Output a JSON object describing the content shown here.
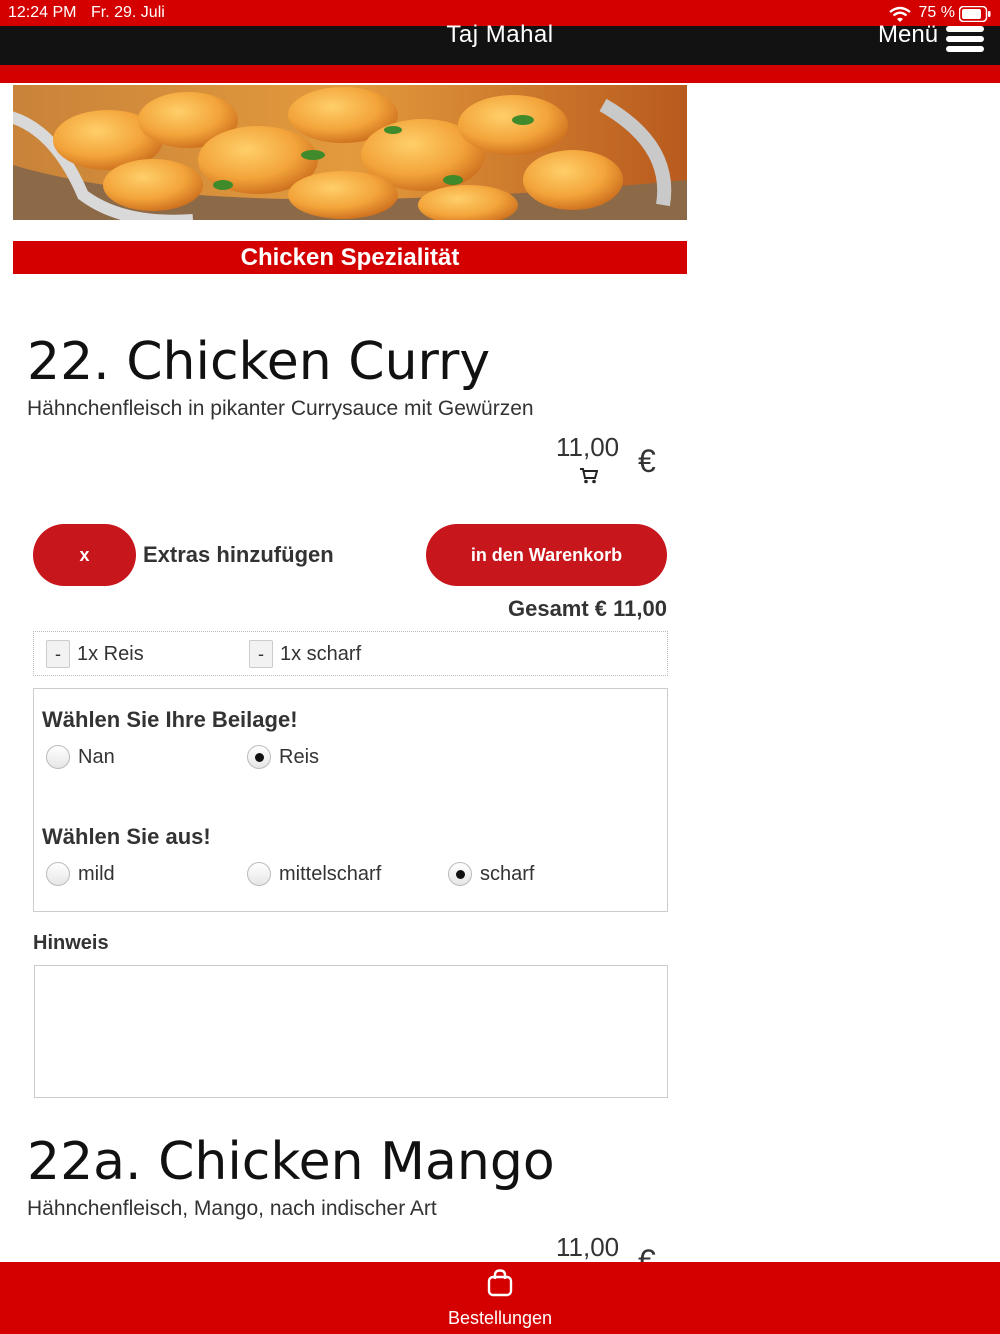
{
  "status_bar": {
    "time": "12:24 PM",
    "date": "Fr. 29. Juli",
    "battery": "75 %"
  },
  "navbar": {
    "title": "Taj Mahal",
    "menu_label": "Menü"
  },
  "category": {
    "title": "Chicken Spezialität"
  },
  "items": [
    {
      "title": "22. Chicken Curry",
      "description": "Hähnchenfleisch in pikanter Currysauce mit Gewürzen",
      "price": "11,00",
      "currency": "€"
    },
    {
      "title": "22a. Chicken Mango",
      "description": "Hähnchenfleisch, Mango, nach indischer Art",
      "price": "11,00",
      "currency": "€"
    }
  ],
  "extras": {
    "close_label": "x",
    "add_label": "Extras hinzufügen",
    "cart_button": "in den Warenkorb",
    "total": "Gesamt € 11,00",
    "selected": [
      {
        "minus": "-",
        "label": "1x Reis"
      },
      {
        "minus": "-",
        "label": "1x scharf"
      }
    ],
    "groups": [
      {
        "title": "Wählen Sie Ihre Beilage!",
        "options": [
          {
            "label": "Nan",
            "checked": false
          },
          {
            "label": "Reis",
            "checked": true
          }
        ]
      },
      {
        "title": "Wählen Sie aus!",
        "options": [
          {
            "label": "mild",
            "checked": false
          },
          {
            "label": "mittelscharf",
            "checked": false
          },
          {
            "label": "scharf",
            "checked": true
          }
        ]
      }
    ],
    "hint_label": "Hinweis",
    "hint_value": ""
  },
  "bottom_bar": {
    "label": "Bestellungen"
  },
  "colors": {
    "brand_red": "#d40000",
    "button_red": "#c8161d",
    "nav_black": "#121212"
  },
  "icons": [
    "wifi-icon",
    "battery-icon",
    "hamburger-icon",
    "cart-icon",
    "shopping-bag-icon"
  ]
}
